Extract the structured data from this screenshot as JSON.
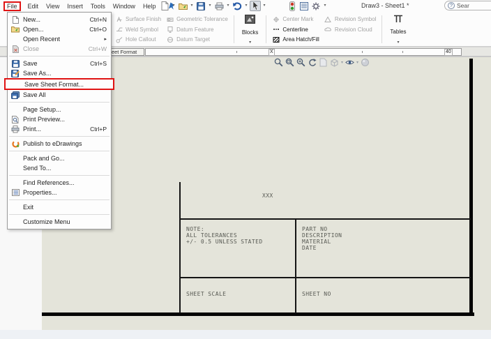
{
  "window": {
    "title": "Draw3 - Sheet1 *",
    "search_text": "Sear",
    "help_glyph": "?"
  },
  "menubar": {
    "items": [
      "File",
      "Edit",
      "View",
      "Insert",
      "Tools",
      "Window",
      "Help"
    ]
  },
  "icons": {
    "submenu_arrow": "▸",
    "caret": "▾"
  },
  "annotation_toolbar": {
    "col1": [
      "Surface Finish",
      "Weld Symbol",
      "Hole Callout"
    ],
    "col2": [
      "Geometric Tolerance",
      "Datum Feature",
      "Datum Target"
    ],
    "blocks_label": "Blocks",
    "col3": [
      "Center Mark",
      "Centerline",
      "Area Hatch/Fill"
    ],
    "col4": [
      "Revision Symbol",
      "Revision Cloud"
    ],
    "tables_label": "Tables"
  },
  "tab_bar": {
    "tab": "Sheet Format",
    "mark_x": "X",
    "mark_40": "40"
  },
  "file_menu": {
    "items": [
      {
        "label": "New...",
        "shortcut": "Ctrl+N"
      },
      {
        "label": "Open...",
        "shortcut": "Ctrl+O"
      },
      {
        "label": "Open Recent",
        "shortcut": ""
      },
      {
        "label": "Close",
        "shortcut": "Ctrl+W"
      },
      {
        "label": "Save",
        "shortcut": "Ctrl+S"
      },
      {
        "label": "Save As...",
        "shortcut": ""
      },
      {
        "label": "Save Sheet Format...",
        "shortcut": ""
      },
      {
        "label": "Save All",
        "shortcut": ""
      },
      {
        "label": "Page Setup...",
        "shortcut": ""
      },
      {
        "label": "Print Preview...",
        "shortcut": ""
      },
      {
        "label": "Print...",
        "shortcut": "Ctrl+P"
      },
      {
        "label": "Publish to eDrawings",
        "shortcut": ""
      },
      {
        "label": "Pack and Go...",
        "shortcut": ""
      },
      {
        "label": "Send To...",
        "shortcut": ""
      },
      {
        "label": "Find References...",
        "shortcut": ""
      },
      {
        "label": "Properties...",
        "shortcut": ""
      },
      {
        "label": "Exit",
        "shortcut": ""
      },
      {
        "label": "Customize Menu",
        "shortcut": ""
      }
    ]
  },
  "drawing": {
    "placeholder": "XXX",
    "title_block": {
      "note_line1": "NOTE:",
      "note_line2": "ALL TOLERANCES",
      "note_line3": "+/- 0.5 UNLESS STATED",
      "info_line1": "PART NO",
      "info_line2": "DESCRIPTION",
      "info_line3": "MATERIAL",
      "info_line4": "DATE",
      "sheet_scale": "SHEET SCALE",
      "sheet_no": "SHEET NO"
    }
  },
  "colors": {
    "sheet": "#e4e4da",
    "highlight_red": "#e01313",
    "disabled_text": "#9f9f9f",
    "accent_blue": "#3f6fae"
  }
}
